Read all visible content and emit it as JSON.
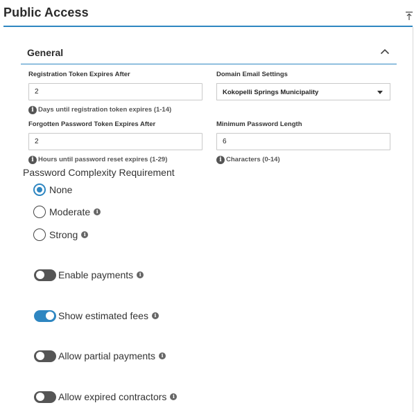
{
  "page": {
    "title": "Public Access"
  },
  "section": {
    "title": "General"
  },
  "fields": {
    "registration_token": {
      "label": "Registration Token Expires After",
      "value": "2",
      "hint": "Days until registration token expires (1-14)"
    },
    "domain_email": {
      "label": "Domain Email Settings",
      "value": "Kokopelli Springs Municipality"
    },
    "forgotten_password_token": {
      "label": "Forgotten Password Token Expires After",
      "value": "2",
      "hint": "Hours until password reset expires (1-29)"
    },
    "min_password_length": {
      "label": "Minimum Password Length",
      "value": "6",
      "hint": "Characters (0-14)"
    }
  },
  "complexity": {
    "label": "Password Complexity Requirement",
    "selected": "None",
    "options": [
      {
        "label": "None",
        "info": false
      },
      {
        "label": "Moderate",
        "info": true
      },
      {
        "label": "Strong",
        "info": true
      }
    ]
  },
  "toggles": [
    {
      "label": "Enable payments",
      "on": false
    },
    {
      "label": "Show estimated fees",
      "on": true
    },
    {
      "label": "Allow partial payments",
      "on": false
    },
    {
      "label": "Allow expired contractors",
      "on": false
    }
  ],
  "icons": {
    "info": "info-icon",
    "collapse_all": "collapse-to-top-icon",
    "section_toggle": "chevron-up-icon",
    "select_caret": "caret-down-icon"
  },
  "colors": {
    "accent": "#2e86c1",
    "toggle_off": "#555555",
    "text": "#333333"
  }
}
